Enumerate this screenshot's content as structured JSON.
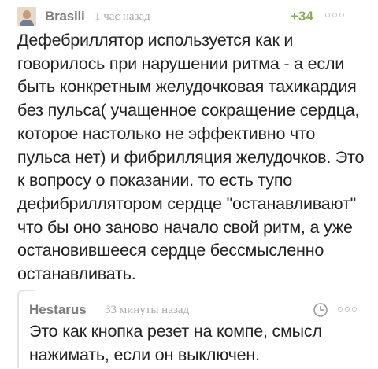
{
  "comment": {
    "author": "Brasili",
    "time": "1 час назад",
    "rating": "+34",
    "avatar_icon": "user-avatar",
    "more_icon": "more-dots-icon",
    "body_lines": [
      "Дефебриллятор используется как и",
      "говорилось при нарушении ритма - а если",
      "быть конкретным желудочковая тахикардия",
      "без пульса( учащенное сокращение сердца,",
      "которое настолько не эффективно что",
      "пульса нет) и фибрилляция желудочков. Это",
      "к вопросу о показании. то есть тупо",
      "дефибриллятором сердце \"останавливают\"",
      "что бы оно заново начало свой ритм, а уже",
      "остановившееся сердце бессмысленно",
      "останавливать."
    ]
  },
  "reply": {
    "author": "Hestarus",
    "time": "33 минуты назад",
    "clock_icon": "clock-icon",
    "more_icon": "more-dots-icon",
    "body_lines": [
      "Это как кнопка резет на компе, смысл",
      "нажимать, если он выключен."
    ]
  },
  "colors": {
    "rating": "#8aab59",
    "author": "#7c7c7c",
    "meta": "#a8a8a8",
    "text": "#222222"
  }
}
